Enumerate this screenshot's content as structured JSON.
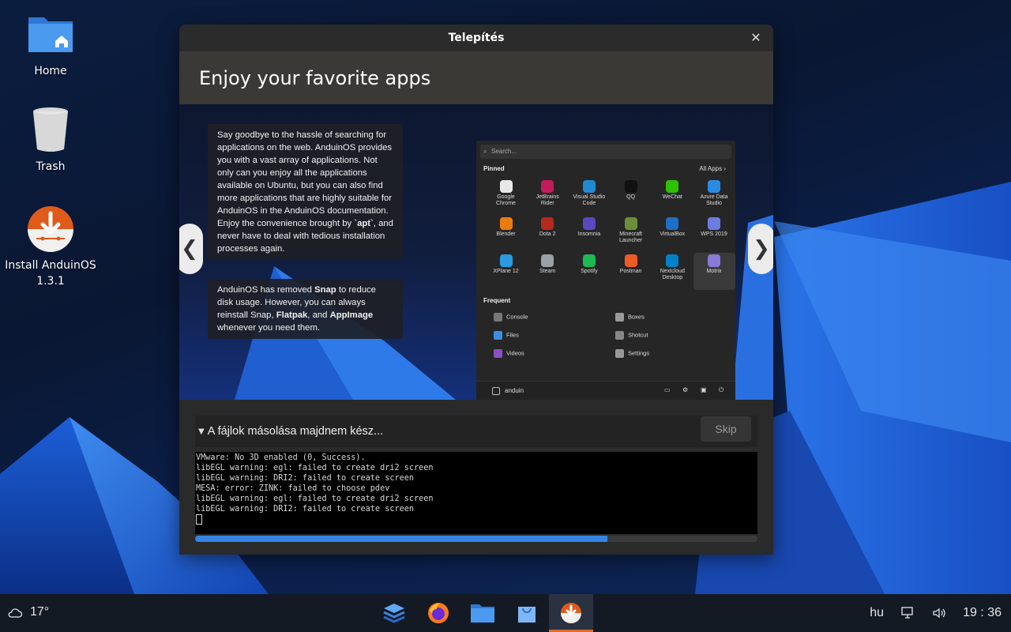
{
  "desktop": {
    "icons": [
      {
        "label": "Home",
        "icon": "home-folder-icon"
      },
      {
        "label": "Trash",
        "icon": "trash-icon"
      },
      {
        "label_line1": "Install AnduinOS",
        "label_line2": "1.3.1",
        "icon": "installer-icon"
      }
    ]
  },
  "window": {
    "title": "Telepítés",
    "slide": {
      "heading": "Enjoy your favorite apps",
      "para1": "Say goodbye to the hassle of searching for applications on the web. AnduinOS provides you with a vast array of applications. Not only can you enjoy all the applications available on Ubuntu, but you can also find more applications that are highly suitable for AnduinOS in the AnduinOS documentation. Enjoy the convenience brought by ",
      "para1_code": "`apt`",
      "para1_end": ", and never have to deal with tedious installation processes again.",
      "para2_a": "AnduinOS has removed ",
      "para2_snap": "Snap",
      "para2_b": " to reduce disk usage. However, you can always reinstall Snap, ",
      "para2_flatpak": "Flatpak",
      "para2_c": ", and ",
      "para2_appimage": "AppImage",
      "para2_d": " whenever you need them.",
      "prev_arrow": "❮",
      "next_arrow": "❯",
      "menu": {
        "search_placeholder": "Search...",
        "pinned_label": "Pinned",
        "all_apps_label": "All Apps",
        "frequent_label": "Frequent",
        "user": "anduin",
        "pinned": [
          {
            "line1": "Google",
            "line2": "Chrome",
            "color": "#e8e8e8"
          },
          {
            "line1": "JetBrains",
            "line2": "Rider",
            "color": "#c21c5c"
          },
          {
            "line1": "Visual Studio",
            "line2": "Code",
            "color": "#1f8ad2"
          },
          {
            "line1": "QQ",
            "line2": "",
            "color": "#111111"
          },
          {
            "line1": "WeChat",
            "line2": "",
            "color": "#2dc100"
          },
          {
            "line1": "Azure Data",
            "line2": "Studio",
            "color": "#2a8ce0"
          },
          {
            "line1": "Blender",
            "line2": "",
            "color": "#e87d0d"
          },
          {
            "line1": "Dota 2",
            "line2": "",
            "color": "#b22b1e"
          },
          {
            "line1": "Insomnia",
            "line2": "",
            "color": "#5849be"
          },
          {
            "line1": "Minecraft",
            "line2": "Launcher",
            "color": "#6a8f3a"
          },
          {
            "line1": "VirtualBox",
            "line2": "",
            "color": "#1f6fc7"
          },
          {
            "line1": "WPS 2019",
            "line2": "",
            "color": "#6b7de0"
          },
          {
            "line1": "XPlane 12",
            "line2": "",
            "color": "#2a9be0"
          },
          {
            "line1": "Steam",
            "line2": "",
            "color": "#9aa0a6"
          },
          {
            "line1": "Spotify",
            "line2": "",
            "color": "#1db954"
          },
          {
            "line1": "Postman",
            "line2": "",
            "color": "#ef5b25"
          },
          {
            "line1": "Nextcloud",
            "line2": "Desktop",
            "color": "#0082c9"
          },
          {
            "line1": "Motrix",
            "line2": "",
            "color": "#8a7ad9"
          }
        ],
        "frequent": [
          {
            "label": "Console",
            "color": "#777"
          },
          {
            "label": "Boxes",
            "color": "#999"
          },
          {
            "label": "Files",
            "color": "#3d8fe0"
          },
          {
            "label": "Shotcut",
            "color": "#888"
          },
          {
            "label": "Videos",
            "color": "#8a4fc2"
          },
          {
            "label": "Settings",
            "color": "#999"
          }
        ]
      }
    },
    "progress": {
      "status": "A fájlok másolása majdnem kész...",
      "skip_label": "Skip",
      "percent": 73.3,
      "log_lines": [
        "VMware: No 3D enabled (0, Success).",
        "libEGL warning: egl: failed to create dri2 screen",
        "libEGL warning: DRI2: failed to create screen",
        "MESA: error: ZINK: failed to choose pdev",
        "libEGL warning: egl: failed to create dri2 screen",
        "libEGL warning: DRI2: failed to create screen"
      ]
    }
  },
  "taskbar": {
    "weather_temp": "17°",
    "weather_icon": "cloud-icon",
    "apps": [
      "task-view-icon",
      "firefox-icon",
      "files-icon",
      "software-store-icon",
      "installer-icon"
    ],
    "language": "hu",
    "time": "19 : 36",
    "accent": "#e06b2a",
    "progress_color": "#3584e4"
  }
}
